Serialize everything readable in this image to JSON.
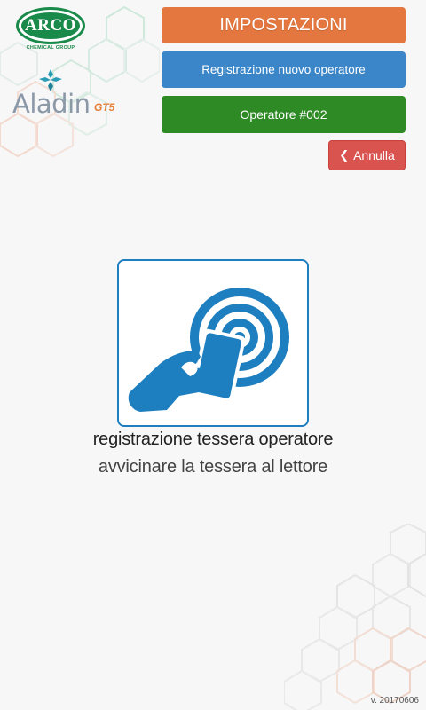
{
  "branding": {
    "arco_word": "ARCO",
    "arco_subtitle": "CHEMICAL GROUP",
    "aladin_word": "Aladin",
    "aladin_model": "GT5"
  },
  "header": {
    "title": "IMPOSTAZIONI",
    "registration_label": "Registrazione nuovo operatore",
    "operator_label": "Operatore #002",
    "cancel_label": "Annulla"
  },
  "main": {
    "prompt_title": "registrazione tessera operatore",
    "prompt_subtitle": "avvicinare la tessera al lettore",
    "icon": "nfc-card-tap-icon"
  },
  "footer": {
    "version": "v. 20170606"
  },
  "colors": {
    "title_bg": "#e4773f",
    "registration_bg": "#3b86c8",
    "operator_bg": "#2e8a24",
    "cancel_bg": "#d9534f",
    "nfc_blue": "#1d7fbf",
    "arco_green": "#1a8a4a"
  }
}
